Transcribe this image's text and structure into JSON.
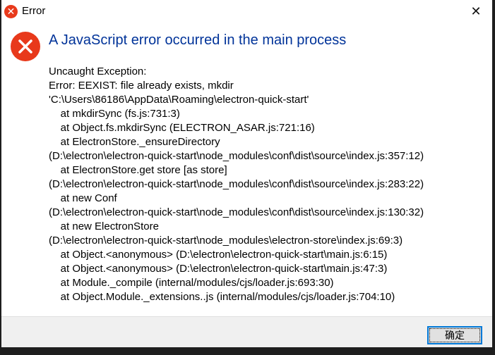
{
  "window": {
    "title": "Error",
    "close_glyph": "✕",
    "icon": "error-icon"
  },
  "dialog": {
    "heading": "A JavaScript error occurred in the main process",
    "message_lines": [
      "Uncaught Exception:",
      "Error: EEXIST: file already exists, mkdir",
      "'C:\\Users\\86186\\AppData\\Roaming\\electron-quick-start'",
      "    at mkdirSync (fs.js:731:3)",
      "    at Object.fs.mkdirSync (ELECTRON_ASAR.js:721:16)",
      "    at ElectronStore._ensureDirectory",
      "(D:\\electron\\electron-quick-start\\node_modules\\conf\\dist\\source\\index.js:357:12)",
      "    at ElectronStore.get store [as store]",
      "(D:\\electron\\electron-quick-start\\node_modules\\conf\\dist\\source\\index.js:283:22)",
      "    at new Conf",
      "(D:\\electron\\electron-quick-start\\node_modules\\conf\\dist\\source\\index.js:130:32)",
      "    at new ElectronStore",
      "(D:\\electron\\electron-quick-start\\node_modules\\electron-store\\index.js:69:3)",
      "    at Object.<anonymous> (D:\\electron\\electron-quick-start\\main.js:6:15)",
      "    at Object.<anonymous> (D:\\electron\\electron-quick-start\\main.js:47:3)",
      "    at Module._compile (internal/modules/cjs/loader.js:693:30)",
      "    at Object.Module._extensions..js (internal/modules/cjs/loader.js:704:10)"
    ],
    "ok_label": "确定"
  },
  "colors": {
    "heading": "#003399",
    "error_red": "#e8391b",
    "focus": "#0078d7"
  }
}
